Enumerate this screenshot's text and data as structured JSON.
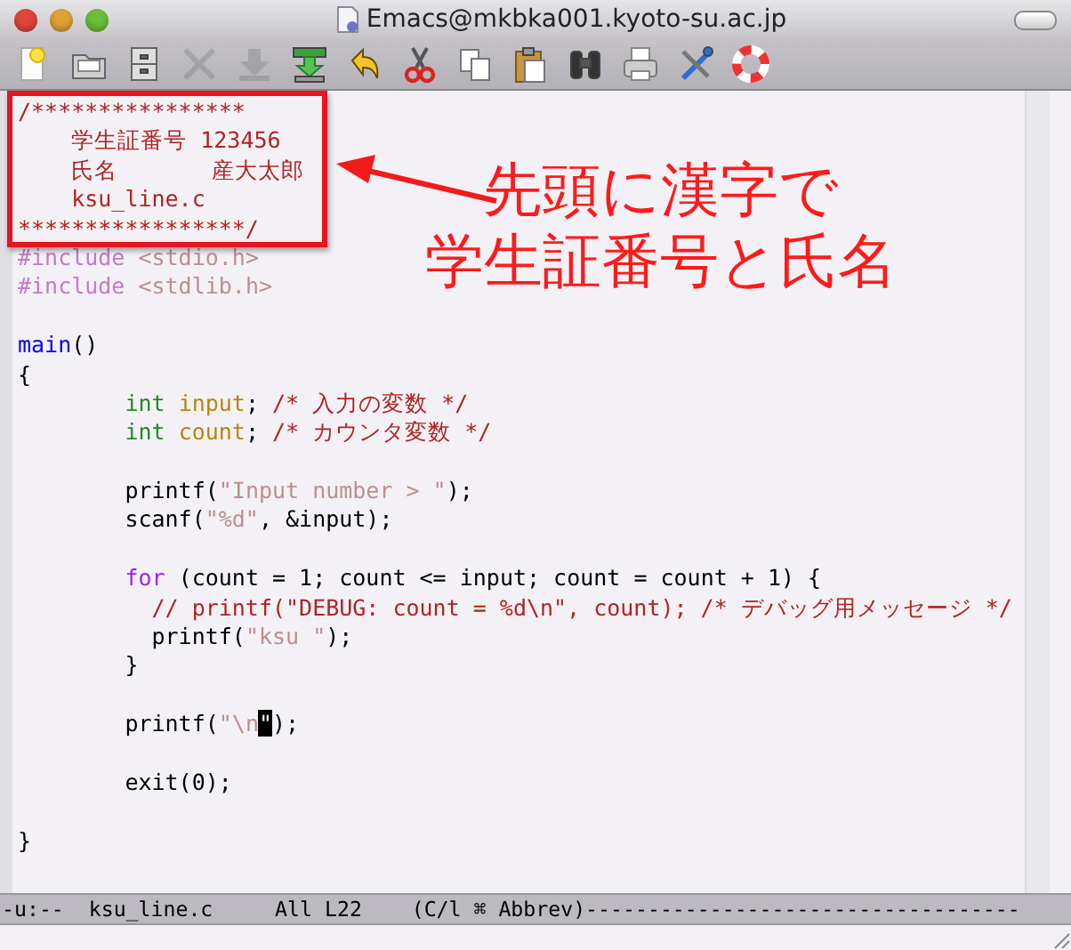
{
  "window": {
    "title": "Emacs@mkbka001.kyoto-su.ac.jp"
  },
  "toolbar": {
    "buttons": [
      {
        "kind": "new",
        "disabled": false
      },
      {
        "kind": "open",
        "disabled": false
      },
      {
        "kind": "save-drawer",
        "disabled": false
      },
      {
        "kind": "close",
        "disabled": true
      },
      {
        "kind": "download",
        "disabled": true
      },
      {
        "kind": "save",
        "disabled": false
      },
      {
        "kind": "undo",
        "disabled": false
      },
      {
        "kind": "cut",
        "disabled": false
      },
      {
        "kind": "copy",
        "disabled": false
      },
      {
        "kind": "paste",
        "disabled": false
      },
      {
        "kind": "search",
        "disabled": false
      },
      {
        "kind": "print",
        "disabled": false
      },
      {
        "kind": "tools",
        "disabled": false
      },
      {
        "kind": "help",
        "disabled": false
      }
    ]
  },
  "editor": {
    "blocks": [
      [
        [
          {
            "kind": "comment",
            "text": "/****************"
          }
        ],
        [
          {
            "kind": "comment",
            "text": "    学生証番号 123456"
          }
        ],
        [
          {
            "kind": "comment",
            "text": "    氏名       産大太郎"
          }
        ],
        [
          {
            "kind": "comment",
            "text": "    ksu_line.c"
          }
        ],
        [
          {
            "kind": "comment",
            "text": "*****************/"
          }
        ],
        [
          {
            "kind": "preproc",
            "text": "#include "
          },
          {
            "kind": "string",
            "text": "<stdio.h>"
          }
        ],
        [
          {
            "kind": "preproc",
            "text": "#include "
          },
          {
            "kind": "string",
            "text": "<stdlib.h>"
          }
        ]
      ],
      [
        [
          {
            "kind": "function",
            "text": "main"
          },
          {
            "kind": "plain",
            "text": "()"
          }
        ],
        [
          {
            "kind": "plain",
            "text": "{"
          }
        ],
        [
          {
            "kind": "type",
            "text": "        int"
          },
          {
            "kind": "variable",
            "text": " input"
          },
          {
            "kind": "plain",
            "text": "; "
          },
          {
            "kind": "comment",
            "text": "/* 入力の変数 */"
          }
        ],
        [
          {
            "kind": "type",
            "text": "        int"
          },
          {
            "kind": "variable",
            "text": " count"
          },
          {
            "kind": "plain",
            "text": "; "
          },
          {
            "kind": "comment",
            "text": "/* カウンタ変数 */"
          }
        ]
      ],
      [
        [
          {
            "kind": "plain",
            "text": "        printf("
          },
          {
            "kind": "string",
            "text": "\"Input number > \""
          },
          {
            "kind": "plain",
            "text": ");"
          }
        ],
        [
          {
            "kind": "plain",
            "text": "        scanf("
          },
          {
            "kind": "string",
            "text": "\"%d\""
          },
          {
            "kind": "plain",
            "text": ", &input);"
          }
        ]
      ],
      [
        [
          {
            "kind": "keyword",
            "text": "        for"
          },
          {
            "kind": "plain",
            "text": " (count = 1; count <= input; count = count + 1) {"
          }
        ],
        [
          {
            "kind": "comment",
            "text": "          // printf(\"DEBUG: count = %d\\n\", count); /* デバッグ用メッセージ */"
          }
        ],
        [
          {
            "kind": "plain",
            "text": "          printf("
          },
          {
            "kind": "string",
            "text": "\"ksu \""
          },
          {
            "kind": "plain",
            "text": ");"
          }
        ],
        [
          {
            "kind": "plain",
            "text": "        }"
          }
        ]
      ],
      [
        [
          {
            "kind": "plain",
            "text": "        printf("
          },
          {
            "kind": "string",
            "text": "\"\\n"
          },
          {
            "kind": "cursor",
            "text": "\""
          },
          {
            "kind": "plain",
            "text": ");"
          }
        ]
      ],
      [
        [
          {
            "kind": "plain",
            "text": "        exit(0);"
          }
        ]
      ],
      [
        [
          {
            "kind": "plain",
            "text": "}"
          }
        ]
      ]
    ]
  },
  "callout": {
    "lines": [
      "先頭に漢字で",
      "学生証番号と氏名"
    ]
  },
  "mode_line": "-u:--  ksu_line.c     All L22    (C/l ⌘ Abbrev)-----------------------------------"
}
